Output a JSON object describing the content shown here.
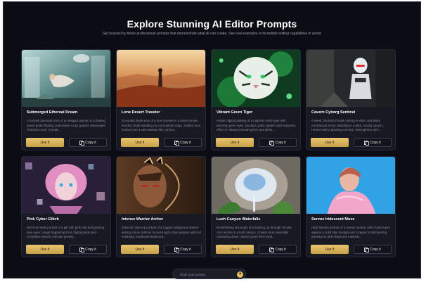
{
  "page": {
    "title": "Explore Stunning AI Editor Prompts",
    "subtitle": "Get inspired by these professional prompts that demonstrate what AI can create. See real examples of incredible editing capabilities in action"
  },
  "buttons": {
    "use_label": "Use It",
    "copy_label": "Copy it"
  },
  "cards": [
    {
      "title": "Submerged Ethereal Dream",
      "description": "A surreal cinematic shot of an elegant woman in a flowing pastel gown floating underwater in an opulent submerged Victorian room. Crystal...",
      "image_icon": "underwater-woman-image"
    },
    {
      "title": "Lone Desert Traveler",
      "description": "Cinematic back view of a lone traveler in a heavy brown hooded cloak standing on a red desert ridge. Golden hour sunset over a vast Martian-like canyon...",
      "image_icon": "desert-traveler-image"
    },
    {
      "title": "Vibrant Green Tiger",
      "description": "Artistic digital painting of a majestic white tiger with piercing green eyes. Dynamic paint splatter and explosion effect in vibrant emerald green and white...",
      "image_icon": "green-tiger-image"
    },
    {
      "title": "Cavern Cyborg Sentinel",
      "description": "A sleek, futuristic female cyborg in white and black mechanical armor standing in a dark, moody cavern. Helmet with a glowing red visor, atmospheric dim...",
      "image_icon": "cyborg-image"
    },
    {
      "title": "Pink Cyber Glitch",
      "description": "Glitch-art style portrait of a girl with pink hair and glowing blue eyes. Image fragmented into digital pixels and crystalline shards, intricate jewelry...",
      "image_icon": "glitch-portrait-image"
    },
    {
      "title": "Intense Warrior Archer",
      "description": "Extreme close-up portrait of a rugged indigenous warrior aiming a bow. Intense focused gaze, face painted with red markings, traditional feathered...",
      "image_icon": "warrior-archer-image"
    },
    {
      "title": "Lush Canyon Waterfalls",
      "description": "Breathtaking low-angle shot looking up through circular rock arches in a lush canyon. Crystal clear waterfalls cascading down, vibrant green ferns and...",
      "image_icon": "canyon-waterfall-image"
    },
    {
      "title": "Serene Iridescent Muse",
      "description": "High-fashion portrait of a serene woman with closed eyes against a solid blue background. Draped in shimmering, translucent pink iridescent material...",
      "image_icon": "iridescent-muse-image"
    }
  ],
  "prompt": {
    "placeholder": "Enter your prompt",
    "send_icon": "sparkle-icon"
  },
  "colors": {
    "accent": "#e3bb5d",
    "background": "#0c0d14",
    "card": "#171923"
  }
}
